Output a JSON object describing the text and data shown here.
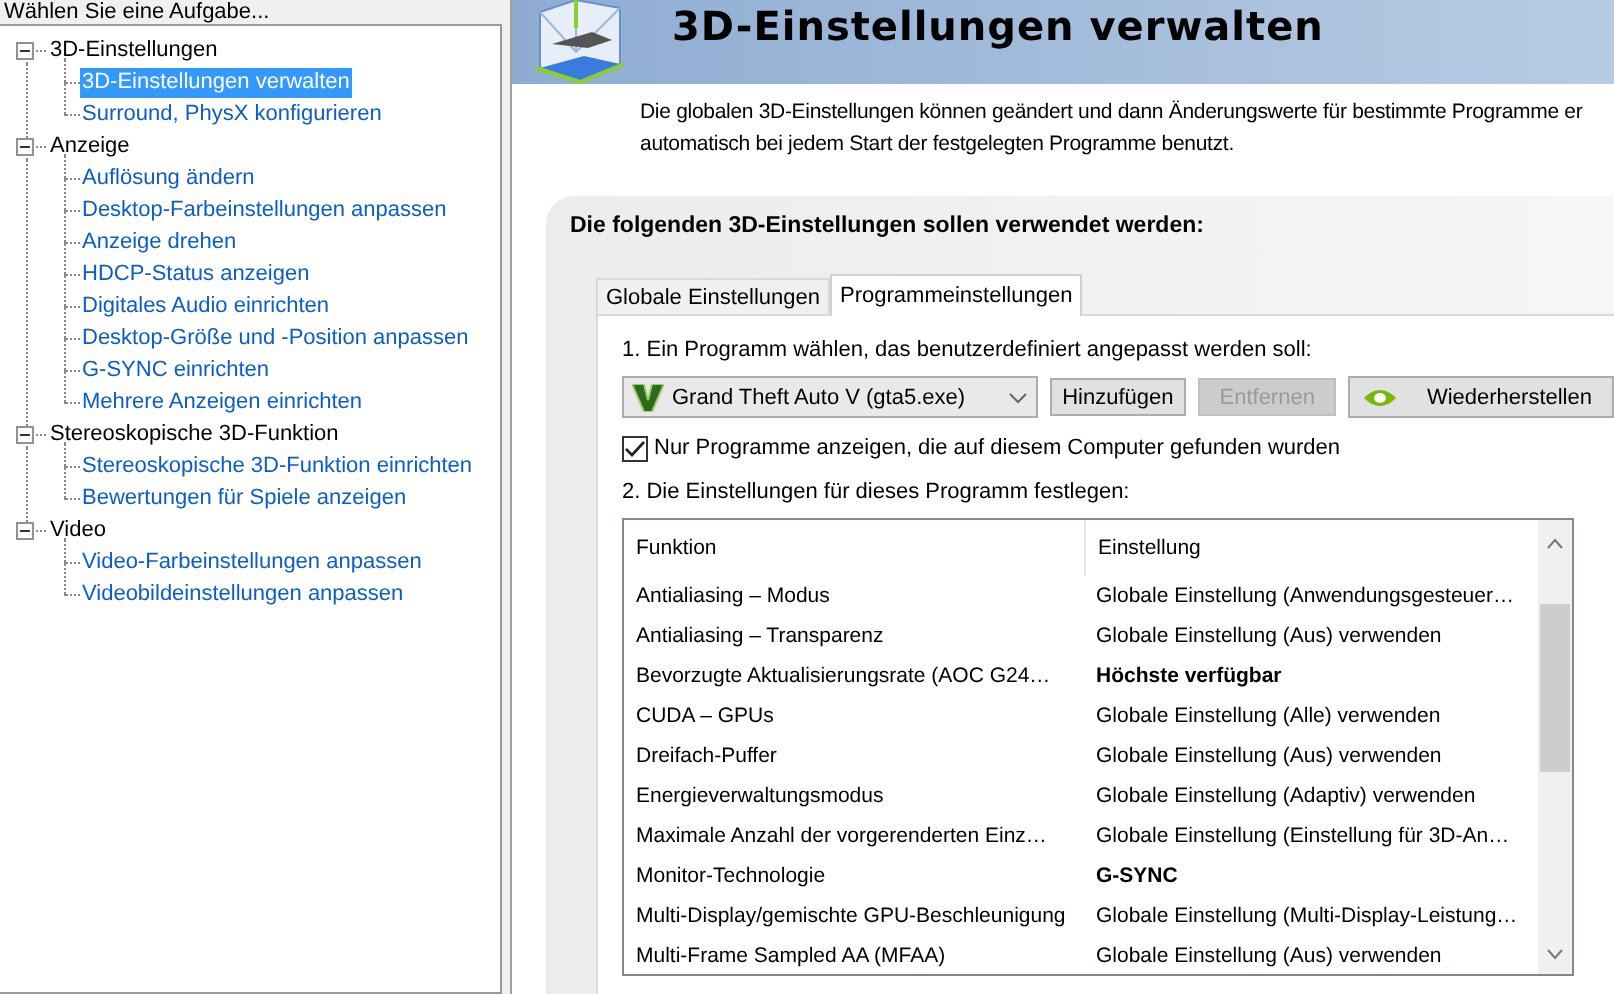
{
  "sidebar": {
    "title": "Wählen Sie eine Aufgabe...",
    "tree": [
      {
        "label": "3D-Einstellungen",
        "expanded": true,
        "children": [
          {
            "label": "3D-Einstellungen verwalten",
            "selected": true
          },
          {
            "label": "Surround, PhysX konfigurieren",
            "selected": false
          }
        ]
      },
      {
        "label": "Anzeige",
        "expanded": true,
        "children": [
          {
            "label": "Auflösung ändern",
            "selected": false
          },
          {
            "label": "Desktop-Farbeinstellungen anpassen",
            "selected": false
          },
          {
            "label": "Anzeige drehen",
            "selected": false
          },
          {
            "label": "HDCP-Status anzeigen",
            "selected": false
          },
          {
            "label": "Digitales Audio einrichten",
            "selected": false
          },
          {
            "label": "Desktop-Größe und -Position anpassen",
            "selected": false
          },
          {
            "label": "G-SYNC einrichten",
            "selected": false
          },
          {
            "label": "Mehrere Anzeigen einrichten",
            "selected": false
          }
        ]
      },
      {
        "label": "Stereoskopische 3D-Funktion",
        "expanded": true,
        "children": [
          {
            "label": "Stereoskopische 3D-Funktion einrichten",
            "selected": false
          },
          {
            "label": "Bewertungen für Spiele anzeigen",
            "selected": false
          }
        ]
      },
      {
        "label": "Video",
        "expanded": true,
        "children": [
          {
            "label": "Video-Farbeinstellungen anpassen",
            "selected": false
          },
          {
            "label": "Videobildeinstellungen anpassen",
            "selected": false
          }
        ]
      }
    ]
  },
  "header": {
    "title": "3D-Einstellungen verwalten"
  },
  "description": [
    "Die globalen 3D-Einstellungen können geändert und dann Änderungswerte für bestimmte Programme er",
    "automatisch bei jedem Start der festgelegten Programme benutzt."
  ],
  "panel": {
    "heading": "Die folgenden 3D-Einstellungen sollen verwendet werden:",
    "tabs": [
      {
        "label": "Globale Einstellungen",
        "selected": false
      },
      {
        "label": "Programmeinstellungen",
        "selected": true
      }
    ],
    "step1": "1. Ein Programm wählen, das benutzerdefiniert angepasst werden soll:",
    "program": {
      "value": "Grand Theft Auto V (gta5.exe)"
    },
    "buttons": [
      {
        "label": "Hinzufügen",
        "kind": "plain",
        "disabled": false
      },
      {
        "label": "Entfernen",
        "kind": "plain",
        "disabled": true
      },
      {
        "label": "Wiederherstellen",
        "kind": "restore",
        "disabled": false
      }
    ],
    "filter": {
      "label": "Nur Programme anzeigen, die auf diesem Computer gefunden wurden",
      "checked": true
    },
    "step2": "2. Die Einstellungen für dieses Programm festlegen:",
    "table": {
      "columns": [
        "Funktion",
        "Einstellung"
      ],
      "rows": [
        {
          "function": "Antialiasing – Modus",
          "setting": "Globale Einstellung (Anwendungsgesteuer…",
          "custom": false
        },
        {
          "function": "Antialiasing – Transparenz",
          "setting": "Globale Einstellung (Aus) verwenden",
          "custom": false
        },
        {
          "function": "Bevorzugte Aktualisierungsrate (AOC G24…",
          "setting": "Höchste verfügbar",
          "custom": true
        },
        {
          "function": "CUDA – GPUs",
          "setting": "Globale Einstellung (Alle) verwenden",
          "custom": false
        },
        {
          "function": "Dreifach-Puffer",
          "setting": "Globale Einstellung (Aus) verwenden",
          "custom": false
        },
        {
          "function": "Energieverwaltungsmodus",
          "setting": "Globale Einstellung (Adaptiv) verwenden",
          "custom": false
        },
        {
          "function": "Maximale Anzahl der vorgerenderten Einz…",
          "setting": "Globale Einstellung (Einstellung für 3D-An…",
          "custom": false
        },
        {
          "function": "Monitor-Technologie",
          "setting": "G-SYNC",
          "custom": true
        },
        {
          "function": "Multi-Display/gemischte GPU-Beschleunigung",
          "setting": "Globale Einstellung (Multi-Display-Leistung…",
          "custom": false
        },
        {
          "function": "Multi-Frame Sampled AA (MFAA)",
          "setting": "Globale Einstellung (Aus) verwenden",
          "custom": false
        }
      ]
    }
  }
}
